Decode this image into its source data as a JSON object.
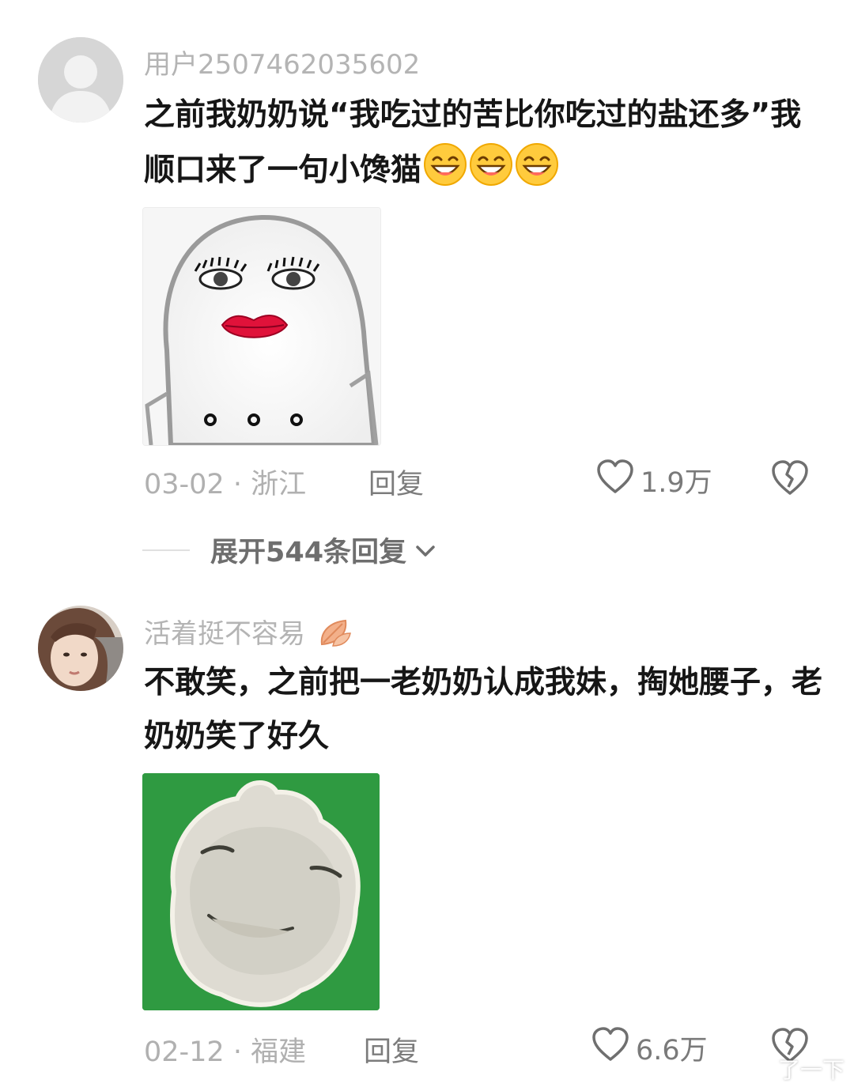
{
  "comments": [
    {
      "username": "用户2507462035602",
      "text": "之前我奶奶说“我吃过的苦比你吃过的盐还多”我顺口来了一句小馋猫",
      "emoji_count": 3,
      "emoji_icon": "grinning-squint-face-icon",
      "sticker": "ghost-lipstick-sticker",
      "date": "03-02",
      "separator": "·",
      "location": "浙江",
      "reply_label": "回复",
      "likes": "1.9万",
      "expand_label": "展开544条回复"
    },
    {
      "username": "活着挺不容易",
      "username_badge": "leaf-icon",
      "text": "不敢笑，之前把一老奶奶认成我妹，掏她腰子，老奶奶笑了好久",
      "sticker": "round-face-green-sticker",
      "date": "02-12",
      "separator": "·",
      "location": "福建",
      "reply_label": "回复",
      "likes": "6.6万"
    }
  ],
  "watermark": "了一下",
  "colors": {
    "text": "#161616",
    "muted": "#b0b0b0",
    "sticker_green": "#2f9a41"
  }
}
